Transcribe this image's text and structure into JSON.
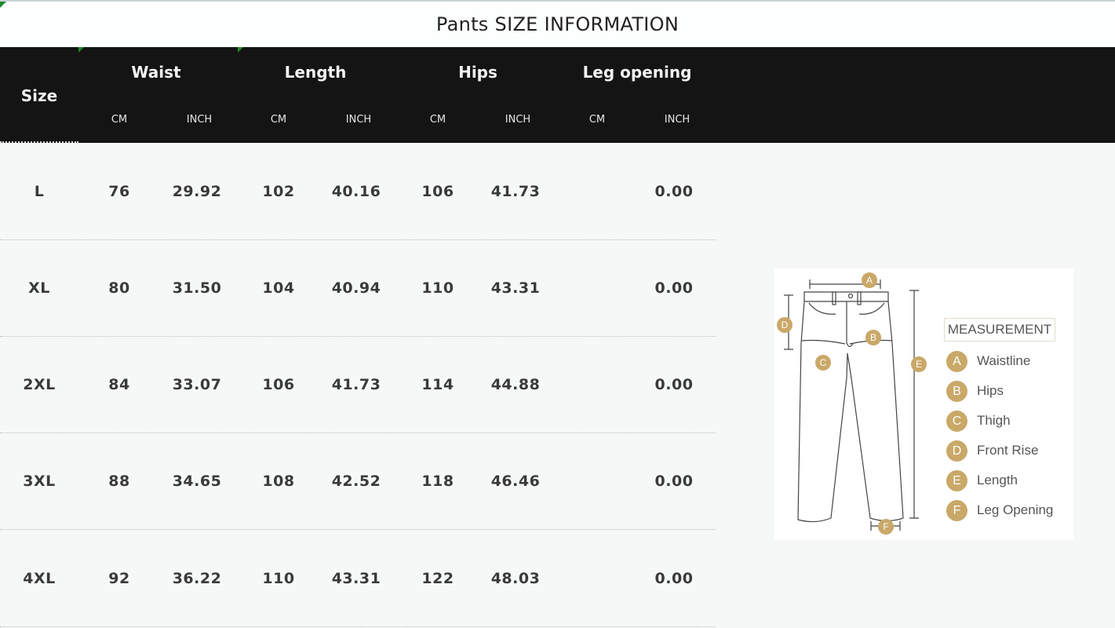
{
  "title": "Pants SIZE INFORMATION",
  "header": {
    "size_label": "Size",
    "groups": [
      "Waist",
      "Length",
      "Hips",
      "Leg opening"
    ],
    "units": [
      "CM",
      "INCH",
      "CM",
      "INCH",
      "CM",
      "INCH",
      "CM",
      "INCH"
    ]
  },
  "rows": [
    {
      "size": "L",
      "values": [
        "76",
        "29.92",
        "102",
        "40.16",
        "106",
        "41.73",
        "",
        "0.00"
      ]
    },
    {
      "size": "XL",
      "values": [
        "80",
        "31.50",
        "104",
        "40.94",
        "110",
        "43.31",
        "",
        "0.00"
      ]
    },
    {
      "size": "2XL",
      "values": [
        "84",
        "33.07",
        "106",
        "41.73",
        "114",
        "44.88",
        "",
        "0.00"
      ]
    },
    {
      "size": "3XL",
      "values": [
        "88",
        "34.65",
        "108",
        "42.52",
        "118",
        "46.46",
        "",
        "0.00"
      ]
    },
    {
      "size": "4XL",
      "values": [
        "92",
        "36.22",
        "110",
        "43.31",
        "122",
        "48.03",
        "",
        "0.00"
      ]
    }
  ],
  "measurement": {
    "title": "MEASUREMENT",
    "items": [
      {
        "letter": "A",
        "label": "Waistline"
      },
      {
        "letter": "B",
        "label": "Hips"
      },
      {
        "letter": "C",
        "label": "Thigh"
      },
      {
        "letter": "D",
        "label": "Front Rise"
      },
      {
        "letter": "E",
        "label": "Length"
      },
      {
        "letter": "F",
        "label": "Leg Opening"
      }
    ]
  },
  "colors": {
    "header_bg": "#141414",
    "badge": "#c9a868",
    "accent_green": "#1e8a2a"
  }
}
